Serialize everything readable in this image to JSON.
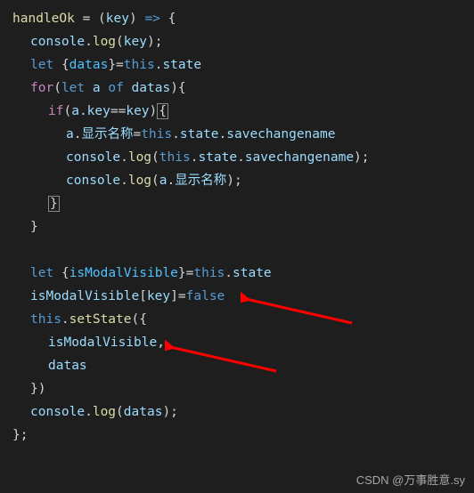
{
  "code": {
    "l1": {
      "fn": "handleOk",
      "eq": " = ",
      "p1": "(",
      "arg": "key",
      "p2": ") ",
      "arrow": "=>",
      "brace": " {"
    },
    "l2": {
      "obj": "console",
      "dot": ".",
      "method": "log",
      "p1": "(",
      "arg": "key",
      "p2": ");"
    },
    "l3": {
      "kw": "let",
      "sp": " ",
      "p1": "{",
      "var": "datas",
      "p2": "}=",
      "this": "this",
      "dot": ".",
      "prop": "state"
    },
    "l4": {
      "kw": "for",
      "p1": "(",
      "kw2": "let",
      "sp": " ",
      "var": "a",
      "sp2": " ",
      "kw3": "of",
      "sp3": " ",
      "var2": "datas",
      "p2": "){"
    },
    "l5": {
      "kw": "if",
      "p1": "(",
      "var": "a",
      "dot": ".",
      "prop": "key",
      "eq": "==",
      "var2": "key",
      "p2": ")",
      "brace": "{"
    },
    "l6": {
      "var": "a",
      "dot": ".",
      "prop": "显示名称",
      "eq": "=",
      "this": "this",
      "dot2": ".",
      "prop2": "state",
      "dot3": ".",
      "prop3": "savechangename"
    },
    "l7": {
      "obj": "console",
      "dot": ".",
      "method": "log",
      "p1": "(",
      "this": "this",
      "dot2": ".",
      "prop": "state",
      "dot3": ".",
      "prop2": "savechangename",
      "p2": ");"
    },
    "l8": {
      "obj": "console",
      "dot": ".",
      "method": "log",
      "p1": "(",
      "var": "a",
      "dot2": ".",
      "prop": "显示名称",
      "p2": ");"
    },
    "l9": {
      "brace": "}"
    },
    "l10": {
      "brace": "}"
    },
    "l12": {
      "kw": "let",
      "sp": " ",
      "p1": "{",
      "var": "isModalVisible",
      "p2": "}=",
      "this": "this",
      "dot": ".",
      "prop": "state"
    },
    "l13": {
      "var": "isModalVisible",
      "p1": "[",
      "key": "key",
      "p2": "]=",
      "val": "false"
    },
    "l14": {
      "this": "this",
      "dot": ".",
      "method": "setState",
      "p1": "({"
    },
    "l15": {
      "var": "isModalVisible",
      "comma": ","
    },
    "l16": {
      "var": "datas"
    },
    "l17": {
      "brace": "})"
    },
    "l18": {
      "obj": "console",
      "dot": ".",
      "method": "log",
      "p1": "(",
      "var": "datas",
      "p2": ");"
    },
    "l19": {
      "brace": "};"
    }
  },
  "watermark": "CSDN @万事胜意.sy"
}
